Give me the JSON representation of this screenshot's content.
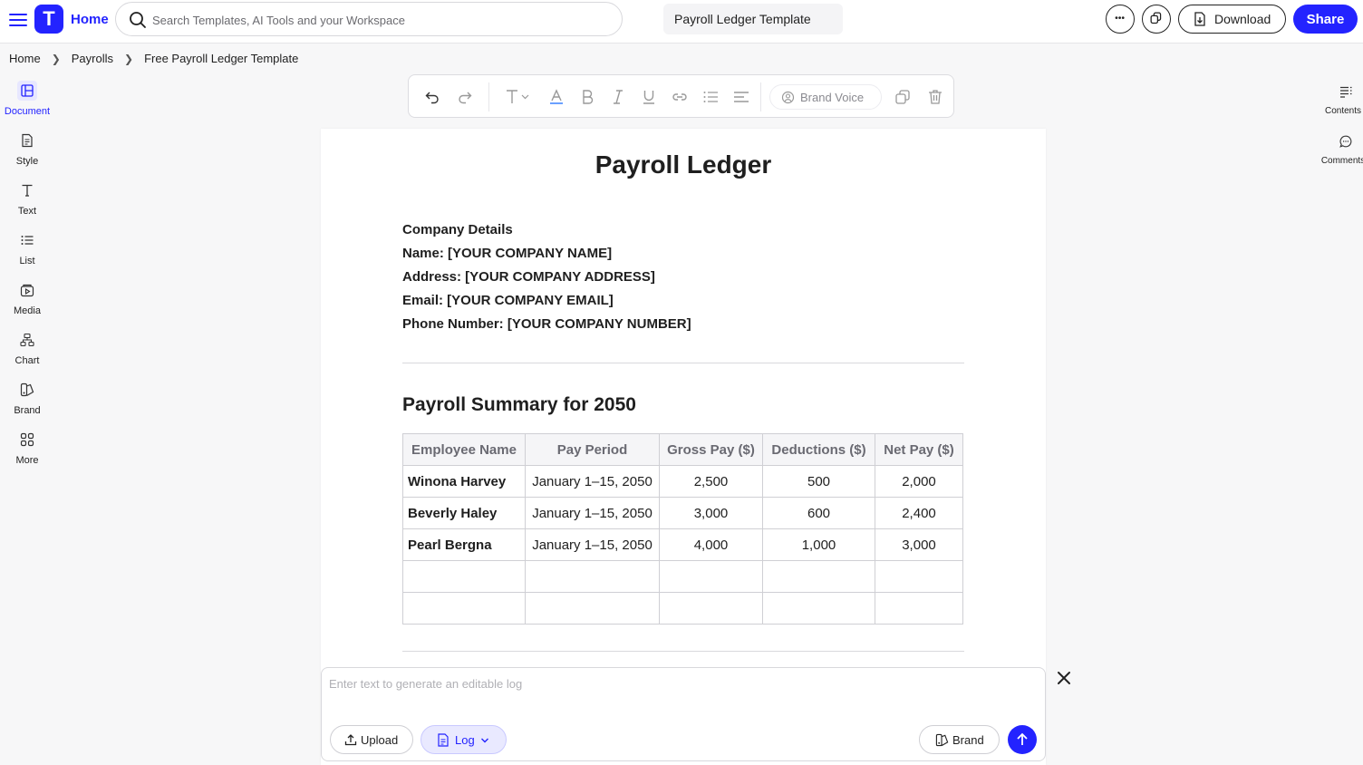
{
  "topbar": {
    "logo_letter": "T",
    "home_label": "Home",
    "search_placeholder": "Search Templates, AI Tools and your Workspace",
    "doc_title": "Payroll Ledger Template",
    "download_label": "Download",
    "share_label": "Share"
  },
  "breadcrumb": [
    "Home",
    "Payrolls",
    "Free Payroll Ledger Template"
  ],
  "left_sidebar": [
    {
      "label": "Document",
      "icon": "layout-icon",
      "active": true
    },
    {
      "label": "Style",
      "icon": "style-icon"
    },
    {
      "label": "Text",
      "icon": "text-icon"
    },
    {
      "label": "List",
      "icon": "list-icon"
    },
    {
      "label": "Media",
      "icon": "media-icon"
    },
    {
      "label": "Chart",
      "icon": "chart-icon"
    },
    {
      "label": "Brand",
      "icon": "brand-icon"
    },
    {
      "label": "More",
      "icon": "grid-icon"
    }
  ],
  "right_sidebar": [
    {
      "label": "Contents",
      "icon": "contents-icon"
    },
    {
      "label": "Comments",
      "icon": "comments-icon"
    }
  ],
  "toolbar": {
    "brand_voice_label": "Brand Voice"
  },
  "document": {
    "title": "Payroll Ledger",
    "company": {
      "heading": "Company Details",
      "name": "Name: [YOUR COMPANY NAME]",
      "address": "Address: [YOUR COMPANY ADDRESS]",
      "email": "Email: [YOUR COMPANY EMAIL]",
      "phone": "Phone Number: [YOUR COMPANY NUMBER]"
    },
    "summary_heading": "Payroll Summary for 2050",
    "table": {
      "headers": [
        "Employee Name",
        "Pay Period",
        "Gross Pay ($)",
        "Deductions ($)",
        "Net Pay ($)"
      ],
      "rows": [
        [
          "Winona Harvey",
          "January 1–15, 2050",
          "2,500",
          "500",
          "2,000"
        ],
        [
          "Beverly Haley",
          "January 1–15, 2050",
          "3,000",
          "600",
          "2,400"
        ],
        [
          "Pearl Bergna",
          "January 1–15, 2050",
          "4,000",
          "1,000",
          "3,000"
        ],
        [
          "",
          "",
          "",
          "",
          ""
        ],
        [
          "",
          "",
          "",
          "",
          ""
        ]
      ]
    }
  },
  "prompt": {
    "placeholder": "Enter text to generate an editable log",
    "upload_label": "Upload",
    "log_label": "Log",
    "brand_label": "Brand"
  },
  "colors": {
    "accent": "#2323ff",
    "accent_light": "#e9e9ff"
  }
}
